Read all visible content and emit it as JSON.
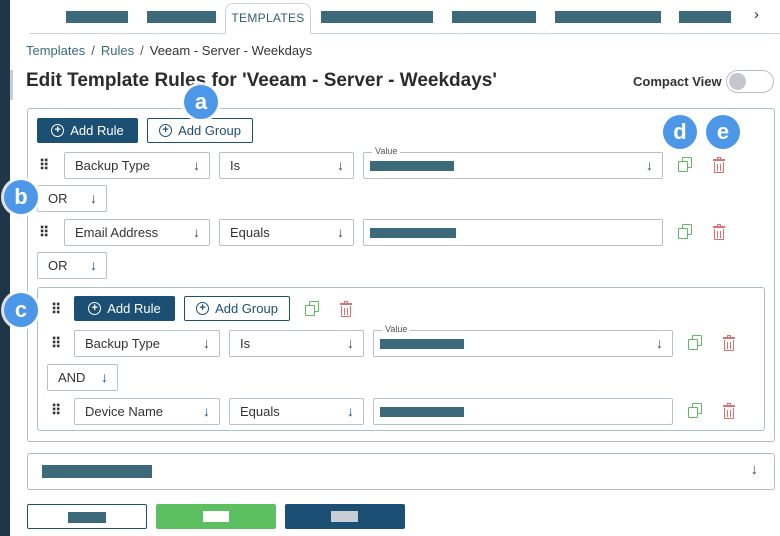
{
  "tabs": {
    "active_label": "TEMPLATES",
    "next_icon": "chevron-right-icon",
    "next_glyph": "›"
  },
  "breadcrumb": {
    "items": [
      "Templates",
      "Rules",
      "Veeam - Server - Weekdays"
    ],
    "separator": "/"
  },
  "page_title": "Edit Template Rules for 'Veeam - Server - Weekdays'",
  "compact_view": {
    "label": "Compact View",
    "enabled": false
  },
  "toolbar": {
    "add_rule_label": "Add Rule",
    "add_group_label": "Add Group"
  },
  "rules": [
    {
      "field": "Backup Type",
      "operator": "Is",
      "value_legend": "Value"
    },
    {
      "field": "Email Address",
      "operator": "Equals"
    }
  ],
  "connectors": {
    "first": "OR",
    "second": "OR",
    "group_inner": "AND"
  },
  "group": {
    "add_rule_label": "Add Rule",
    "add_group_label": "Add Group",
    "rules": [
      {
        "field": "Backup Type",
        "operator": "Is",
        "value_legend": "Value"
      },
      {
        "field": "Device Name",
        "operator": "Equals"
      }
    ]
  },
  "annotations": [
    "a",
    "b",
    "c",
    "d",
    "e"
  ],
  "glyphs": {
    "arrow_down": "↓",
    "plus": "+",
    "drag": "⠿"
  },
  "colors": {
    "primary": "#1c4f74",
    "copy_green": "#62b765",
    "delete_red": "#e07070",
    "marker_blue": "#4d97e8",
    "redacted_teal": "#3d6a7a",
    "success_green": "#5cbf60"
  }
}
